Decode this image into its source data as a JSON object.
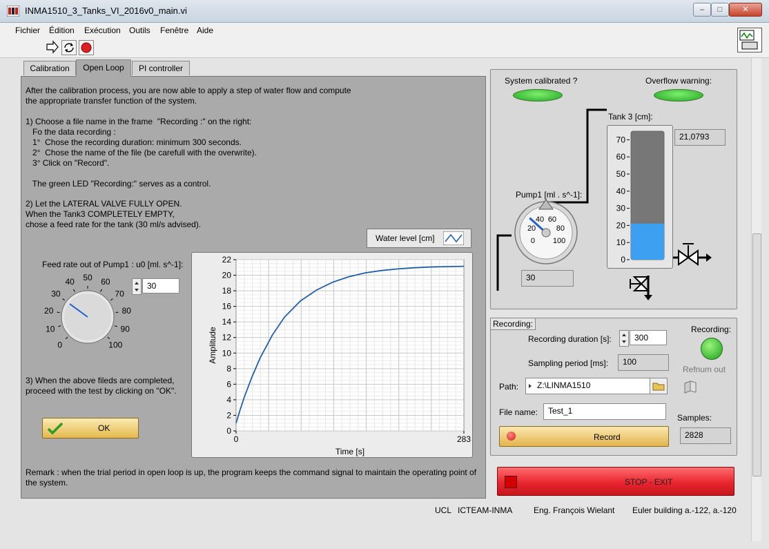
{
  "window": {
    "title": "INMA1510_3_Tanks_VI_2016v0_main.vi",
    "controls": {
      "minimize": "–",
      "maximize": "□",
      "close": "✕"
    }
  },
  "menu": [
    "Fichier",
    "Édition",
    "Exécution",
    "Outils",
    "Fenêtre",
    "Aide"
  ],
  "tabs": [
    "Calibration",
    "Open Loop",
    "PI controller"
  ],
  "active_tab": "Open Loop",
  "instructions": {
    "intro": [
      "After the calibration process, you are now able to apply a step of water flow and compute",
      "the appropriate transfer function of the system."
    ],
    "step1": [
      "1) Choose a file name in the frame  \"Recording :\" on the right:",
      "   Fo the data recording :",
      "   1°  Chose the recording duration: minimum 300 seconds.",
      "   2°  Chose the name of the file (be carefull with the overwrite).",
      "   3° Click on \"Record\"."
    ],
    "led_note": "   The green LED \"Recording:\" serves as a control.",
    "step2": [
      "2) Let the LATERAL VALVE FULLY OPEN.",
      "When the Tank3 COMPLETELY EMPTY,",
      "chose a feed rate for the tank (30 ml/s advised)."
    ],
    "step3": [
      "3) When the above fileds are completed,",
      "proceed with the test by clicking on \"OK\"."
    ],
    "remark": [
      "Remark : when the trial period in open loop is up, the program keeps the command signal to maintain the operating point of",
      "the system."
    ]
  },
  "feed_knob": {
    "label": "Feed rate out of Pump1 : u0 [ml. s^-1]:",
    "ticks": [
      "0",
      "10",
      "20",
      "30",
      "40",
      "50",
      "60",
      "70",
      "80",
      "90",
      "100"
    ],
    "value": 30,
    "numeric": "30"
  },
  "ok_button": "OK",
  "water_legend": "Water level [cm]",
  "chart_data": {
    "type": "line",
    "xlabel": "Time [s]",
    "ylabel": "Amplitude",
    "xlim": [
      0,
      283
    ],
    "ylim": [
      0,
      22
    ],
    "xticks": [
      "0",
      "283"
    ],
    "yticks": [
      "0",
      "2",
      "4",
      "6",
      "8",
      "10",
      "12",
      "14",
      "16",
      "18",
      "20",
      "22"
    ],
    "grid": true,
    "series": [
      {
        "name": "Water level [cm]",
        "color": "#1f5fa8",
        "x": [
          0,
          5,
          10,
          20,
          30,
          45,
          60,
          80,
          100,
          120,
          140,
          160,
          180,
          200,
          220,
          240,
          260,
          283
        ],
        "y": [
          1.0,
          2.7,
          4.3,
          7.0,
          9.4,
          12.3,
          14.6,
          16.7,
          18.1,
          19.1,
          19.8,
          20.3,
          20.6,
          20.8,
          20.95,
          21.05,
          21.1,
          21.15
        ]
      }
    ]
  },
  "status": {
    "calibrated_label": "System calibrated ?",
    "overflow_label": "Overflow warning:"
  },
  "tank3": {
    "label": "Tank 3 [cm]:",
    "ticks": [
      "0",
      "10",
      "20",
      "30",
      "40",
      "50",
      "60",
      "70"
    ],
    "level": 21.0793,
    "max": 75,
    "readout": "21,0793"
  },
  "pump1": {
    "label": "Pump1 [ml . s^-1]:",
    "ticks": [
      "0",
      "20",
      "40",
      "60",
      "80",
      "100"
    ],
    "value": 30,
    "readout": "30"
  },
  "recording": {
    "frame_label": "Recording:",
    "duration_label": "Recording duration [s]:",
    "duration_value": "300",
    "sampling_label": "Sampling period [ms]:",
    "sampling_value": "100",
    "path_label": "Path:",
    "path_value": "Z:\\LINMA1510",
    "filename_label": "File name:",
    "filename_value": "Test_1",
    "record_button": "Record",
    "led_label": "Recording:",
    "refnum_label": "Refnum out",
    "samples_label": "Samples:",
    "samples_value": "2828"
  },
  "stop_button": "STOP - EXIT",
  "footer": {
    "ucl": "UCL",
    "dept": "ICTEAM-INMA",
    "author": "Eng. François Wielant",
    "building": "Euler building a.-122, a.-120"
  },
  "colors": {
    "panel": "#aaaaaa",
    "led_green": "#22c222",
    "water": "#3ea0f0",
    "stop": "#e8252f",
    "series": "#1f5fa8"
  }
}
